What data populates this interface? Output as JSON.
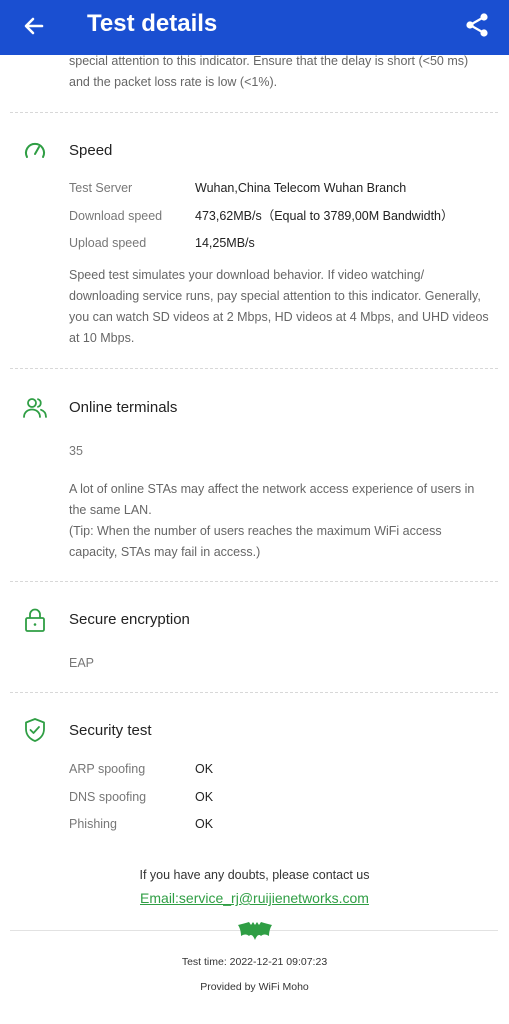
{
  "header": {
    "title": "Test details",
    "back_icon": "arrow-left-icon",
    "share_icon": "share-icon",
    "bg_color": "#1a4fd1"
  },
  "latency_note": {
    "line1": "special attention to this indicator. Ensure that the delay is short (<50 ms)",
    "line2": "and the packet loss rate is low (<1%)."
  },
  "speed": {
    "title": "Speed",
    "icon": "speedometer-icon",
    "rows": [
      {
        "label": "Test Server",
        "value": "Wuhan,China Telecom Wuhan Branch"
      },
      {
        "label": "Download speed",
        "value": "473,62MB/s（Equal to 3789,00M Bandwidth）"
      },
      {
        "label": "Upload speed",
        "value": "14,25MB/s"
      }
    ],
    "note_lines": [
      "Speed test simulates your download behavior. If video watching/",
      "downloading service runs, pay special attention to this indicator. Generally,",
      "you can watch SD videos at 2 Mbps, HD videos at 4 Mbps, and UHD videos",
      "at 10 Mbps."
    ]
  },
  "terminals": {
    "title": "Online terminals",
    "icon": "users-icon",
    "count": "35",
    "note_lines": [
      "A lot of online STAs may affect the network access experience of users in",
      "the same LAN.",
      "(Tip: When the number of users reaches the maximum WiFi access",
      "capacity, STAs may fail in access.)"
    ]
  },
  "encryption": {
    "title": "Secure encryption",
    "icon": "lock-icon",
    "value": "EAP"
  },
  "security": {
    "title": "Security test",
    "icon": "shield-check-icon",
    "rows": [
      {
        "label": "ARP spoofing",
        "value": "OK"
      },
      {
        "label": "DNS spoofing",
        "value": "OK"
      },
      {
        "label": "Phishing",
        "value": "OK"
      }
    ]
  },
  "footer": {
    "contact_text": "If you have any doubts, please contact us",
    "email": "Email:service_rj@ruijienetworks.com",
    "logo_icon": "bat-logo-icon",
    "test_time": "Test time: 2022-12-21 09:07:23",
    "provided_by": "Provided by WiFi Moho"
  },
  "colors": {
    "accent_green": "#2f9e44",
    "divider": "#d8d8d8"
  }
}
